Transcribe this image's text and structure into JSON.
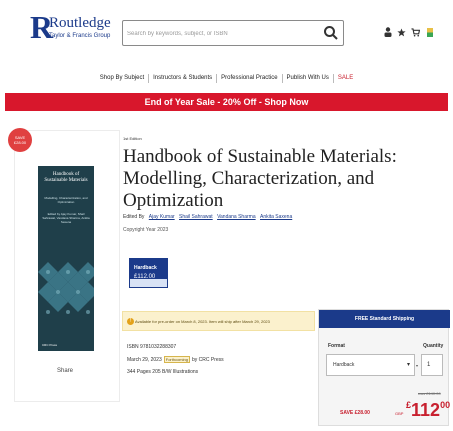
{
  "header": {
    "logo_name": "Routledge",
    "logo_sub": "Taylor & Francis Group",
    "search_placeholder": "Search by keywords, subject, or ISBN",
    "icons": [
      "user-icon",
      "wishlist-icon",
      "cart-icon",
      "currency-flag-icon"
    ]
  },
  "nav": {
    "items": [
      "Shop By Subject",
      "Instructors & Students",
      "Professional Practice",
      "Publish With Us",
      "SALE"
    ]
  },
  "banner": {
    "text": "End of Year Sale - 20% Off - Shop Now"
  },
  "sale_badge": {
    "line1": "SAVE",
    "line2": "£28.00"
  },
  "book": {
    "series": "1st Edition",
    "title": "Handbook of Sustainable Materials: Modelling, Characterization, and Optimization",
    "edited_by_label": "Edited By",
    "editors": [
      "Ajay Kumar",
      "Shail Sahrawat",
      "Vandana Sharma",
      "Ankita Saxena"
    ],
    "copyright": "Copyright Year 2023",
    "cover_title": "Handbook of Sustainable Materials",
    "cover_subtitle": "Modelling, Characterization, and Optimization",
    "cover_editors": "Edited by Ajay Kumar, Shail Sahrawat, Vandana Sharma, Ankita Saxena",
    "cover_publisher": "CRC Press",
    "share": "Share",
    "format_label": "Hardback",
    "format_price": "£112.00",
    "availability": "Available for pre-order on March 8, 2023. Item will ship after March 29, 2023",
    "isbn": "ISBN 9781032288307",
    "pub_date": "March 29, 2023",
    "forthcoming": "Forthcoming",
    "publisher": "by CRC Press",
    "pages": "344 Pages 205 B/W Illustrations"
  },
  "purchase": {
    "shipping": "FREE Standard Shipping",
    "format_label": "Format",
    "quantity_label": "Quantity",
    "format_value": "Hardback",
    "quantity_value": "1",
    "was_price": "was £140.00",
    "save": "SAVE £28.00",
    "rrp": "GBP",
    "price_currency": "£",
    "price_value": "112",
    "price_cents": "00"
  },
  "colors": {
    "brand_blue": "#1b3a8a",
    "sale_red": "#d8172c",
    "avail_bg": "#fbf1cd"
  }
}
